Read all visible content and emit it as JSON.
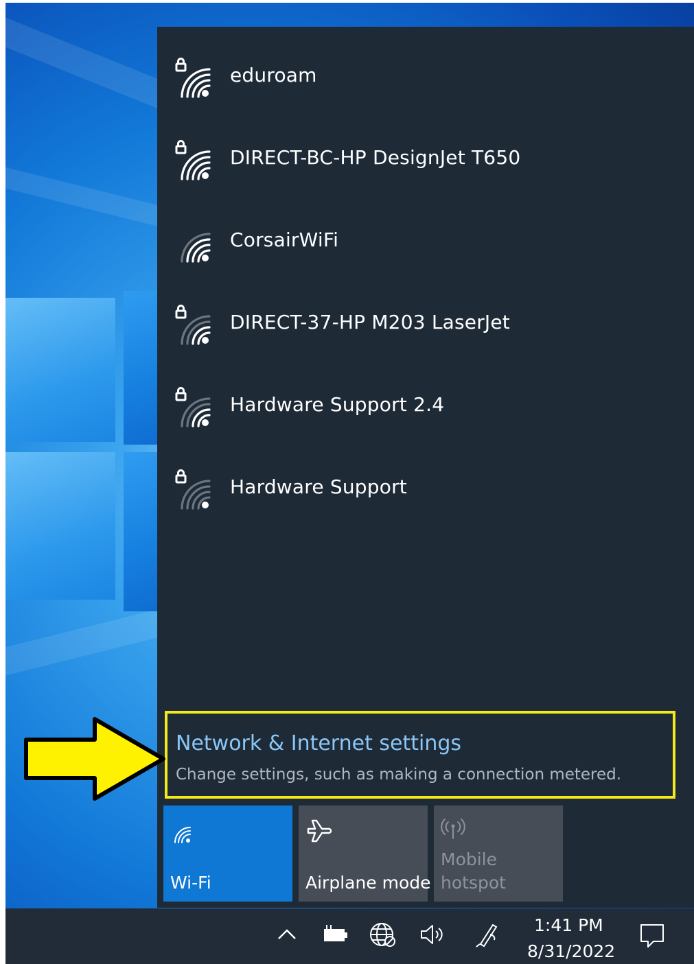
{
  "networks": [
    {
      "ssid": "eduroam",
      "secured": true,
      "signal": 4,
      "icon": "wifi-secured-icon"
    },
    {
      "ssid": "DIRECT-BC-HP DesignJet T650",
      "secured": true,
      "signal": 4,
      "icon": "wifi-secured-icon"
    },
    {
      "ssid": "CorsairWiFi",
      "secured": false,
      "signal": 3,
      "icon": "wifi-icon"
    },
    {
      "ssid": "DIRECT-37-HP M203 LaserJet",
      "secured": true,
      "signal": 2,
      "icon": "wifi-secured-icon"
    },
    {
      "ssid": "Hardware Support 2.4",
      "secured": true,
      "signal": 2,
      "icon": "wifi-secured-icon"
    },
    {
      "ssid": "Hardware Support",
      "secured": true,
      "signal": 1,
      "icon": "wifi-secured-icon"
    }
  ],
  "settings_link": {
    "title": "Network & Internet settings",
    "description": "Change settings, such as making a connection metered."
  },
  "quick_actions": {
    "wifi": {
      "label": "Wi-Fi",
      "active": true
    },
    "airplane": {
      "label": "Airplane mode",
      "active": false
    },
    "hotspot": {
      "label_line1": "Mobile",
      "label_line2": "hotspot",
      "enabled": false
    }
  },
  "taskbar": {
    "time": "1:41 PM",
    "date": "8/31/2022",
    "icons": [
      "chevron-up-icon",
      "battery-icon",
      "network-globe-icon",
      "volume-icon",
      "pen-icon",
      "action-center-icon"
    ]
  },
  "colors": {
    "flyout_bg": "#1f2a37",
    "accent": "#0f78d4",
    "link": "#8bc7f5",
    "highlight": "#f2ea1a"
  }
}
